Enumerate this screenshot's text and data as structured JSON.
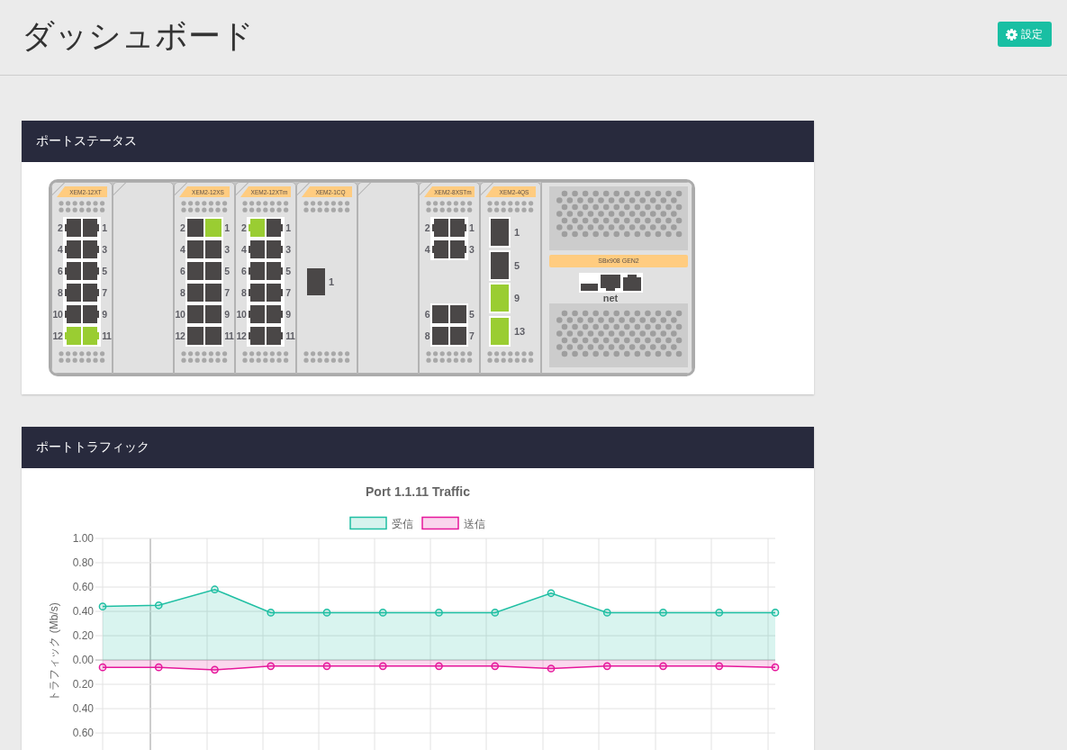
{
  "header": {
    "title": "ダッシュボード",
    "settings_button": "設定"
  },
  "port_status": {
    "title": "ポートステータス",
    "chassis": {
      "slots": [
        {
          "kind": "pairs",
          "model": "XEM2-12XT",
          "groups": [
            {
              "ports": [
                {
                  "label": "2",
                  "kind": "rj45",
                  "up": false
                },
                {
                  "label": "1",
                  "kind": "rj45",
                  "up": false
                },
                {
                  "label": "4",
                  "kind": "rj45",
                  "up": false
                },
                {
                  "label": "3",
                  "kind": "rj45",
                  "up": false
                },
                {
                  "label": "6",
                  "kind": "rj45",
                  "up": false
                },
                {
                  "label": "5",
                  "kind": "rj45",
                  "up": false
                },
                {
                  "label": "8",
                  "kind": "rj45",
                  "up": false
                },
                {
                  "label": "7",
                  "kind": "rj45",
                  "up": false
                },
                {
                  "label": "10",
                  "kind": "rj45",
                  "up": false
                },
                {
                  "label": "9",
                  "kind": "rj45",
                  "up": false
                },
                {
                  "label": "12",
                  "kind": "rj45",
                  "up": true
                },
                {
                  "label": "11",
                  "kind": "rj45",
                  "up": true
                }
              ]
            }
          ]
        },
        {
          "kind": "blank"
        },
        {
          "kind": "pairs",
          "model": "XEM2-12XS",
          "groups": [
            {
              "ports": [
                {
                  "label": "2",
                  "kind": "sfp",
                  "up": false
                },
                {
                  "label": "1",
                  "kind": "sfp",
                  "up": true
                },
                {
                  "label": "4",
                  "kind": "sfp",
                  "up": false
                },
                {
                  "label": "3",
                  "kind": "sfp",
                  "up": false
                },
                {
                  "label": "6",
                  "kind": "sfp",
                  "up": false
                },
                {
                  "label": "5",
                  "kind": "sfp",
                  "up": false
                },
                {
                  "label": "8",
                  "kind": "sfp",
                  "up": false
                },
                {
                  "label": "7",
                  "kind": "sfp",
                  "up": false
                },
                {
                  "label": "10",
                  "kind": "sfp",
                  "up": false
                },
                {
                  "label": "9",
                  "kind": "sfp",
                  "up": false
                },
                {
                  "label": "12",
                  "kind": "sfp",
                  "up": false
                },
                {
                  "label": "11",
                  "kind": "sfp",
                  "up": false
                }
              ]
            }
          ]
        },
        {
          "kind": "pairs",
          "model": "XEM2-12XTm",
          "groups": [
            {
              "ports": [
                {
                  "label": "2",
                  "kind": "rj45",
                  "up": true
                },
                {
                  "label": "1",
                  "kind": "rj45",
                  "up": false
                },
                {
                  "label": "4",
                  "kind": "rj45",
                  "up": false
                },
                {
                  "label": "3",
                  "kind": "rj45",
                  "up": false
                },
                {
                  "label": "6",
                  "kind": "rj45",
                  "up": false
                },
                {
                  "label": "5",
                  "kind": "rj45",
                  "up": false
                },
                {
                  "label": "8",
                  "kind": "rj45",
                  "up": false
                },
                {
                  "label": "7",
                  "kind": "rj45",
                  "up": false
                },
                {
                  "label": "10",
                  "kind": "rj45",
                  "up": false
                },
                {
                  "label": "9",
                  "kind": "rj45",
                  "up": false
                },
                {
                  "label": "12",
                  "kind": "rj45",
                  "up": false
                },
                {
                  "label": "11",
                  "kind": "rj45",
                  "up": false
                }
              ]
            }
          ]
        },
        {
          "kind": "single",
          "model": "XEM2-1CQ",
          "ports": [
            {
              "label": "1",
              "kind": "qsfp",
              "up": false
            }
          ]
        },
        {
          "kind": "blank"
        },
        {
          "kind": "pairs",
          "model": "XEM2-8XSTm",
          "groups": [
            {
              "ports": [
                {
                  "label": "2",
                  "kind": "rj45",
                  "up": false
                },
                {
                  "label": "1",
                  "kind": "rj45",
                  "up": false
                },
                {
                  "label": "4",
                  "kind": "rj45",
                  "up": false
                },
                {
                  "label": "3",
                  "kind": "rj45",
                  "up": false
                }
              ]
            },
            {
              "ports": [
                {
                  "label": "6",
                  "kind": "sfp",
                  "up": false
                },
                {
                  "label": "5",
                  "kind": "sfp",
                  "up": false
                },
                {
                  "label": "8",
                  "kind": "sfp",
                  "up": false
                },
                {
                  "label": "7",
                  "kind": "sfp",
                  "up": false
                }
              ]
            }
          ]
        },
        {
          "kind": "column",
          "model": "XEM2-4QS",
          "ports": [
            {
              "label": "1",
              "kind": "qsfp",
              "up": false
            },
            {
              "label": "5",
              "kind": "qsfp",
              "up": false
            },
            {
              "label": "9",
              "kind": "qsfp",
              "up": true
            },
            {
              "label": "13",
              "kind": "qsfp",
              "up": true
            }
          ]
        },
        {
          "kind": "controller",
          "model": "SBx908 GEN2",
          "net_label": "net"
        }
      ]
    }
  },
  "port_traffic": {
    "title": "ポートトラフィック",
    "chart_data": {
      "type": "area",
      "title": "Port 1.1.11 Traffic",
      "ylabel": "トラフィック (Mb/s)",
      "legend": "top",
      "grid": true,
      "series": [
        {
          "name": "受信",
          "color": "#1fbfa3",
          "values": [
            0.44,
            0.45,
            0.58,
            0.39,
            0.39,
            0.39,
            0.39,
            0.39,
            0.55,
            0.39,
            0.39,
            0.39,
            0.39
          ]
        },
        {
          "name": "送信",
          "color": "#e6179b",
          "values": [
            -0.06,
            -0.06,
            -0.08,
            -0.05,
            -0.05,
            -0.05,
            -0.05,
            -0.05,
            -0.07,
            -0.05,
            -0.05,
            -0.05,
            -0.06
          ]
        }
      ],
      "ylim": [
        -0.74,
        1
      ],
      "yticks": [
        {
          "value": 1,
          "label": "1.00"
        },
        {
          "value": 0.8,
          "label": "0.80"
        },
        {
          "value": 0.6,
          "label": "0.60"
        },
        {
          "value": 0.4,
          "label": "0.40"
        },
        {
          "value": 0.2,
          "label": "0.20"
        },
        {
          "value": 0,
          "label": "0.00"
        },
        {
          "value": -0.2,
          "label": "0.20"
        },
        {
          "value": -0.4,
          "label": "0.40"
        },
        {
          "value": -0.6,
          "label": "0.60"
        }
      ]
    }
  }
}
